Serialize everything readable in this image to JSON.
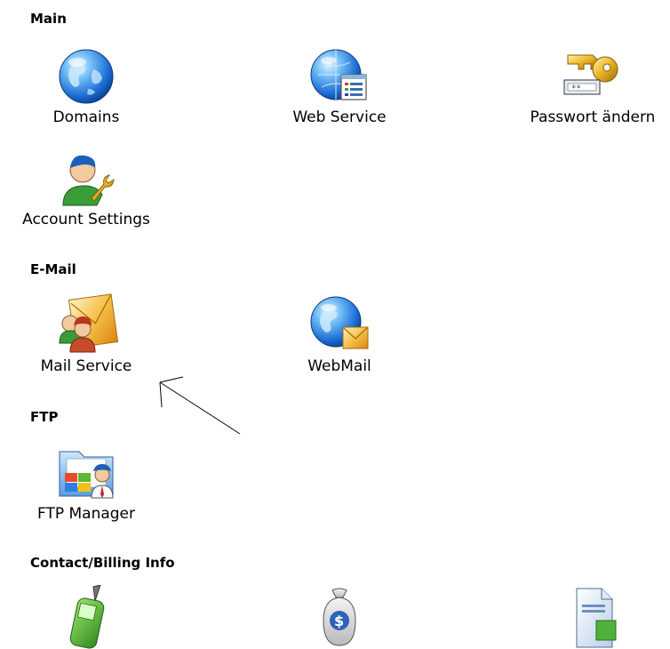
{
  "sections": {
    "main": {
      "title": "Main",
      "items": {
        "domains": {
          "label": "Domains",
          "icon": "globe-icon"
        },
        "web_service": {
          "label": "Web Service",
          "icon": "web-service-icon"
        },
        "password": {
          "label": "Passwort ändern",
          "icon": "key-icon"
        },
        "account": {
          "label": "Account Settings",
          "icon": "user-wrench-icon"
        }
      }
    },
    "email": {
      "title": "E-Mail",
      "items": {
        "mail_service": {
          "label": "Mail Service",
          "icon": "mail-users-icon"
        },
        "webmail": {
          "label": "WebMail",
          "icon": "globe-mail-icon"
        }
      }
    },
    "ftp": {
      "title": "FTP",
      "items": {
        "ftp_manager": {
          "label": "FTP Manager",
          "icon": "ftp-folder-icon"
        }
      }
    },
    "contact": {
      "title": "Contact/Billing Info",
      "items": {
        "phone": {
          "icon": "mobile-phone-icon"
        },
        "billing": {
          "icon": "money-bag-icon"
        },
        "invoice": {
          "icon": "document-icon"
        }
      }
    }
  },
  "colors": {
    "globe_blue": "#1e6fd6",
    "globe_light": "#8fd0ff",
    "key_gold": "#e8b423",
    "envelope_orange": "#f0a02a",
    "text": "#000000"
  }
}
